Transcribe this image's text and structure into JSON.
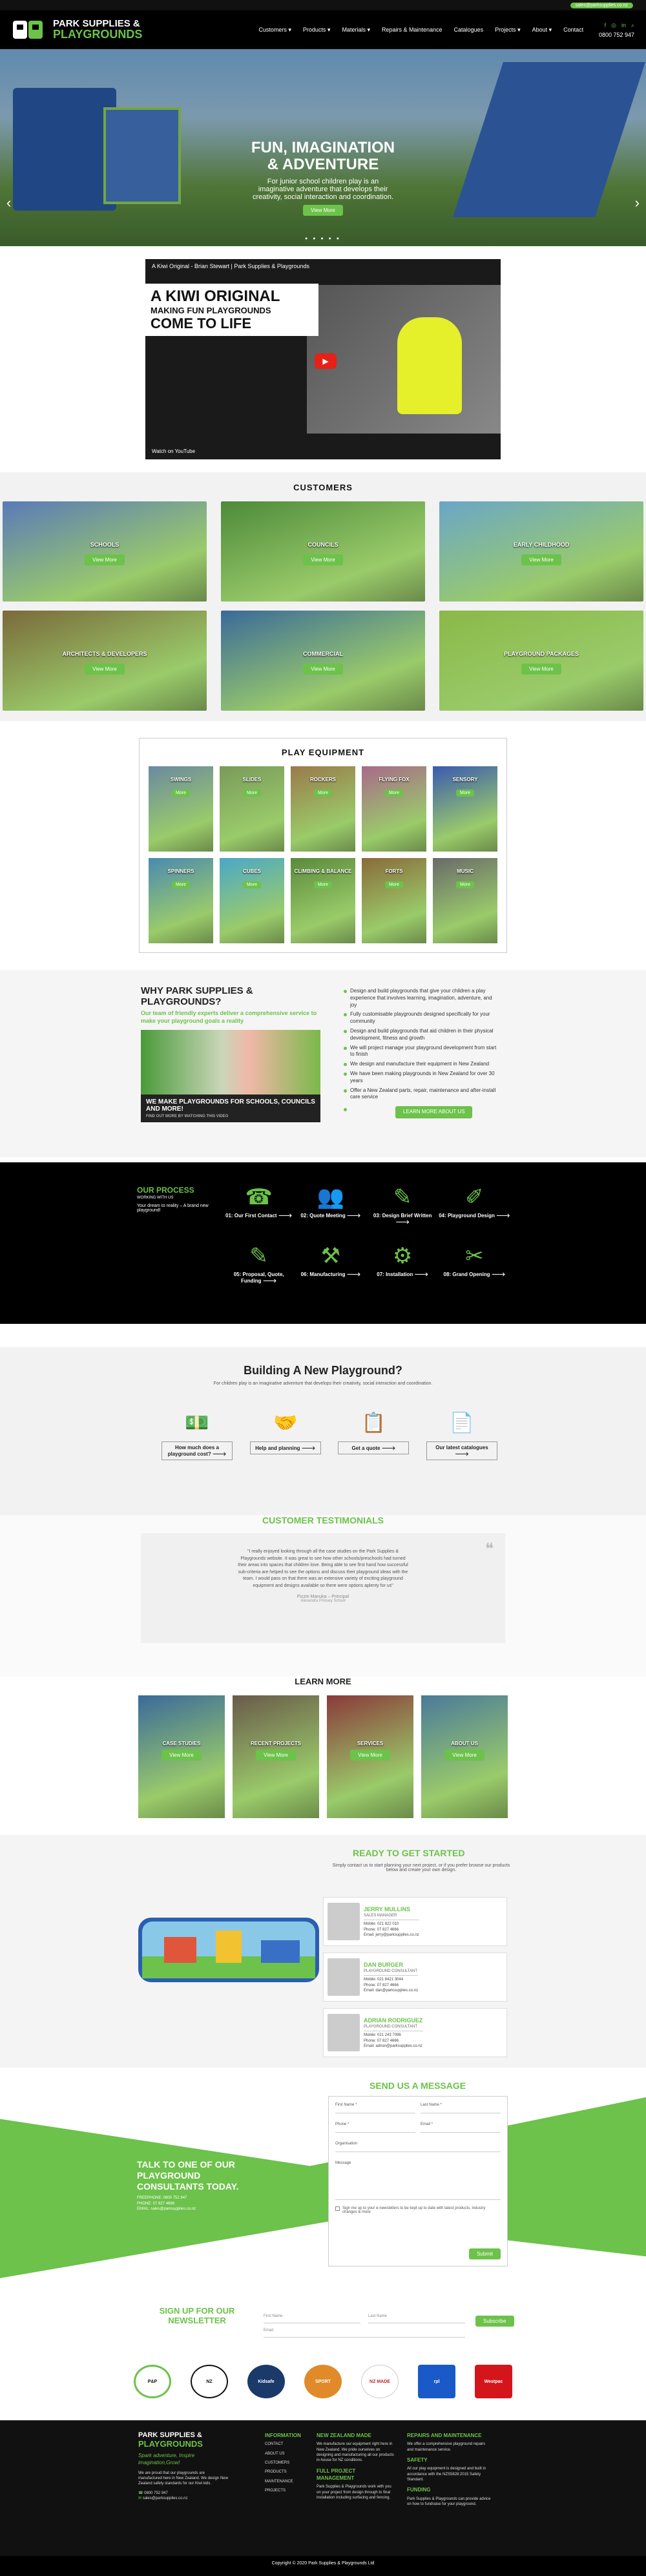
{
  "topbar": {
    "email": "sales@parksupplies.co.nz"
  },
  "brand": {
    "line1": "PARK SUPPLIES &",
    "line2": "PLAYGROUNDS"
  },
  "nav": [
    "Customers ▾",
    "Products ▾",
    "Materials ▾",
    "Repairs & Maintenance",
    "Catalogues",
    "Projects ▾",
    "About ▾",
    "Contact"
  ],
  "header": {
    "phone": "0800 752 947"
  },
  "hero": {
    "title": "FUN, IMAGINATION & ADVENTURE",
    "text": "For junior school children play is an imaginative adventure that develops their creativity, social interaction and coordination.",
    "button": "View More",
    "prev": "‹",
    "next": "›",
    "dots": "● ● ● ● ●"
  },
  "video": {
    "title": "A Kiwi Original - Brian Stewart | Park Supplies & Playgrounds",
    "line1": "A KIWI ORIGINAL",
    "line2": "MAKING FUN PLAYGROUNDS",
    "line3": "COME TO LIFE",
    "watch": "Watch on YouTube"
  },
  "customers": {
    "title": "CUSTOMERS",
    "items": [
      {
        "label": "SCHOOLS",
        "button": "View More",
        "color": "#5a7ab8"
      },
      {
        "label": "COUNCILS",
        "button": "View More",
        "color": "#4d8a3a"
      },
      {
        "label": "EARLY CHILDHOOD",
        "button": "View More",
        "color": "#6aa6c8"
      },
      {
        "label": "ARCHITECTS & DEVELOPERS",
        "button": "View More",
        "color": "#7a6a3a"
      },
      {
        "label": "COMMERCIAL",
        "button": "View More",
        "color": "#3a6a9a"
      },
      {
        "label": "PLAYGROUND PACKAGES",
        "button": "View More",
        "color": "#8ab848"
      }
    ]
  },
  "equipment": {
    "title": "PLAY EQUIPMENT",
    "items": [
      {
        "label": "SWINGS",
        "button": "More",
        "color": "#6a8aa0"
      },
      {
        "label": "SLIDES",
        "button": "More",
        "color": "#7a9a5a"
      },
      {
        "label": "ROCKERS",
        "button": "More",
        "color": "#9a7a4a"
      },
      {
        "label": "FLYING FOX",
        "button": "More",
        "color": "#a86a8a"
      },
      {
        "label": "SENSORY",
        "button": "More",
        "color": "#3a5ab0"
      },
      {
        "label": "SPINNERS",
        "button": "More",
        "color": "#4a8ab0"
      },
      {
        "label": "CUBES",
        "button": "More",
        "color": "#4aa8c8"
      },
      {
        "label": "CLIMBING & BALANCE",
        "button": "More",
        "color": "#5a8a3a"
      },
      {
        "label": "FORTS",
        "button": "More",
        "color": "#8a6a3a"
      },
      {
        "label": "MUSIC",
        "button": "More",
        "color": "#6a6a6a"
      }
    ]
  },
  "why": {
    "title": "WHY PARK SUPPLIES & PLAYGROUNDS?",
    "sub": "Our team of friendly experts deliver a comprehensive service to make your playground goals a reality",
    "banner": "WE MAKE PLAYGROUNDS FOR SCHOOLS, COUNCILS AND MORE!",
    "banner_small": "FIND OUT MORE BY WATCHING THIS VIDEO",
    "points": [
      "Design and build playgrounds that give your children a play experience that involves learning, imagination, adventure, and joy",
      "Fully customisable playgrounds designed specifically for your community",
      "Design and build playgrounds that aid children in their physical development, fitness and growth",
      "We will project manage your playground development from start to finish",
      "We design and manufacture their equipment in New Zealand",
      "We have been making playgrounds in New Zealand for over 30 years",
      "Offer a New Zealand parts, repair, maintenance and after-install care service"
    ],
    "button": "LEARN MORE ABOUT US"
  },
  "process": {
    "title": "OUR PROCESS",
    "working": "WORKING WITH US",
    "text": "Your dream to reality – A brand new playground!",
    "steps": [
      {
        "label": "01: Our First Contact 🡒",
        "icon": "☎"
      },
      {
        "label": "02: Quote Meeting 🡒",
        "icon": "👥"
      },
      {
        "label": "03: Design Brief Written 🡒",
        "icon": "✎"
      },
      {
        "label": "04: Playground Design 🡒",
        "icon": "✐"
      },
      {
        "label": "05: Proposal, Quote, Funding 🡒",
        "icon": "✎"
      },
      {
        "label": "06: Manufacturing 🡒",
        "icon": "⚒"
      },
      {
        "label": "07: Installation 🡒",
        "icon": "⚙"
      },
      {
        "label": "08: Grand Opening 🡒",
        "icon": "✂"
      }
    ]
  },
  "build": {
    "title": "Building A New Playground?",
    "sub": "For children play is an imaginative adventure that develops their creativity, social interaction and coordination.",
    "items": [
      {
        "label": "How much does a playground cost? 🡒",
        "icon": "💵"
      },
      {
        "label": "Help and planning 🡒",
        "icon": "🤝"
      },
      {
        "label": "Get a quote 🡒",
        "icon": "📋"
      },
      {
        "label": "Our latest catalogues 🡒",
        "icon": "📄"
      }
    ]
  },
  "testimonials": {
    "title": "CUSTOMER TESTIMONIALS",
    "quote": "\"I really enjoyed looking through all the case studies on the Park Supplies & Playgrounds website. It was great to see how other schools/preschools had turned their areas into spaces that children love. Being able to see first hand how successful sub-criteria are helped to see the options and discuss their playground ideas with the team. I would pass on that there was an extensive variety of exciting playground equipment and designs available so there were options aplenty for us\"",
    "name": "Pizzie Manuka – Principal",
    "school": "Alexandra Primary School",
    "qmark": "❝"
  },
  "learn": {
    "title": "LEARN MORE",
    "items": [
      {
        "label": "CASE STUDIES",
        "button": "View More",
        "color": "#3a6a9a"
      },
      {
        "label": "RECENT PROJECTS",
        "button": "View More",
        "color": "#6a5a4a"
      },
      {
        "label": "SERVICES",
        "button": "View More",
        "color": "#8a3a3a"
      },
      {
        "label": "ABOUT US",
        "button": "View More",
        "color": "#4a7a9a"
      }
    ]
  },
  "ready": {
    "title": "READY TO GET STARTED",
    "intro": "Simply contact us to start planning your next project, or if you prefer browse our products below and create your own design.",
    "contacts": [
      {
        "name": "JERRY MULLINS",
        "role": "SALES MANAGER",
        "mobile": "Mobile: 021 822 010",
        "phone": "Phone: 07 827 4666",
        "email": "Email: jerry@parksupplies.co.nz"
      },
      {
        "name": "DAN BURGER",
        "role": "PLAYGROUND CONSULTANT",
        "mobile": "Mobile: 021 8421 3044",
        "phone": "Phone: 07 827 4666",
        "email": "Email: dan@parksupplies.co.nz"
      },
      {
        "name": "ADRIAN RODRIGUEZ",
        "role": "PLAYGROUND CONSULTANT",
        "mobile": "Mobile: 021 243 7096",
        "phone": "Phone: 07 827 4666",
        "email": "Email: adrian@parksupplies.co.nz"
      }
    ]
  },
  "message": {
    "title": "SEND US A MESSAGE",
    "talk": "TALK TO ONE OF OUR PLAYGROUND CONSULTANTS TODAY.",
    "freephone": "FREEPHONE: 0800 752 947",
    "phone": "PHONE: 07 827 4666",
    "email": "EMAIL: sales@parksupplies.co.nz",
    "fields": [
      "First Name *",
      "Last Name *",
      "Phone *",
      "Email *",
      "Organisation",
      "Message"
    ],
    "consent": "Sign me up to your e-newsletters to be kept up to date with latest products, industry changes & more",
    "submit": "Submit"
  },
  "newsletter": {
    "title": "SIGN UP FOR OUR NEWSLETTER",
    "first": "First Name",
    "last": "Last Name",
    "email": "Email",
    "button": "Subscribe"
  },
  "partners": [
    "P&P",
    "NZ",
    "Kidsafe",
    "SPORT",
    "NZ MADE",
    "rpl",
    "Westpac"
  ],
  "footer": {
    "tagline": "Spark adventure, Inspire imagination,Grow!",
    "about": "We are proud that our playgrounds are manufactured here in New Zealand. We design New Zealand safety standards for our Kiwi kids.",
    "phone": "0800 752 947",
    "email": "sales@parksupplies.co.nz",
    "info_title": "INFORMATION",
    "info": [
      "CONTACT",
      "ABOUT US",
      "CUSTOMERS",
      "PRODUCTS",
      "MAINTENANCE",
      "PROJECTS"
    ],
    "nzmade_title": "NEW ZEALAND MADE",
    "nzmade": "We manufacture our equipment right here in New Zealand. We pride ourselves on designing and manufacturing all our products in-house for NZ conditions.",
    "pm_title": "FULL PROJECT MANAGEMENT",
    "pm": "Park Supplies & Playgrounds work with you on your project from design through to final installation including surfacing and fencing.",
    "repair_title": "REPAIRS AND MAINTENANCE",
    "repair": "We offer a comprehensive playground repairs and maintenance service.",
    "safety_title": "SAFETY",
    "safety": "All our play equipment is designed and built in accordance with the NZS5828:2015 Safety Standard.",
    "funding_title": "FUNDING",
    "funding": "Park Supplies & Playgrounds can provide advice on how to fundraise for your playground."
  },
  "copyright": "Copyright © 2020 Park Supplies & Playgrounds Ltd",
  "colors": {
    "accent": "#6cc24a",
    "dark": "#000000"
  }
}
